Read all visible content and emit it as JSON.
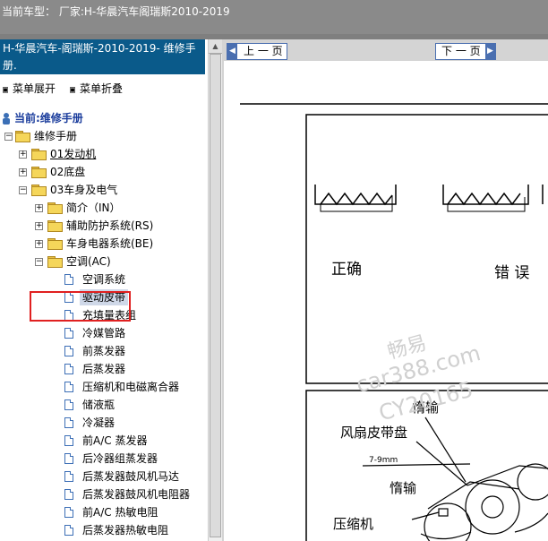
{
  "topbar": {
    "title": "当前车型：  厂家:H-华晨汽车阁瑞斯2010-2019"
  },
  "left": {
    "header": "H-华晨汽车-阁瑞斯-2010-2019- 维修手册.",
    "expand_all": "菜单展开",
    "collapse_all": "菜单折叠",
    "current": "当前:维修手册",
    "tree": [
      {
        "label": "维修手册"
      },
      {
        "label": "01发动机"
      },
      {
        "label": "02底盘"
      },
      {
        "label": "03车身及电气"
      },
      {
        "label": "简介（IN）"
      },
      {
        "label": "辅助防护系统(RS)"
      },
      {
        "label": "车身电器系统(BE)"
      },
      {
        "label": "空调(AC)"
      },
      {
        "label": "空调系统"
      },
      {
        "label": "驱动皮带"
      },
      {
        "label": "充填量表组"
      },
      {
        "label": "冷媒管路"
      },
      {
        "label": "前蒸发器"
      },
      {
        "label": "后蒸发器"
      },
      {
        "label": "压缩机和电磁离合器"
      },
      {
        "label": "储液瓶"
      },
      {
        "label": "冷凝器"
      },
      {
        "label": "前A/C 蒸发器"
      },
      {
        "label": "后冷器组蒸发器"
      },
      {
        "label": "后蒸发器鼓风机马达"
      },
      {
        "label": "后蒸发器鼓风机电阻器"
      },
      {
        "label": "前A/C 热敏电阻"
      },
      {
        "label": "后蒸发器热敏电阻"
      }
    ]
  },
  "right": {
    "prev_label": "上 一 页",
    "next_label": "下 一 页",
    "doc": {
      "correct": "正确",
      "wrong": "错 误",
      "idler_top": "惰输",
      "fan_pulley": "风扇皮带盘",
      "dim": "7-9mm",
      "idler_mid": "惰输",
      "compressor": "压缩机"
    },
    "watermark": {
      "line1": "畅易",
      "line2": "car388.com",
      "line3": "CY20165"
    }
  }
}
